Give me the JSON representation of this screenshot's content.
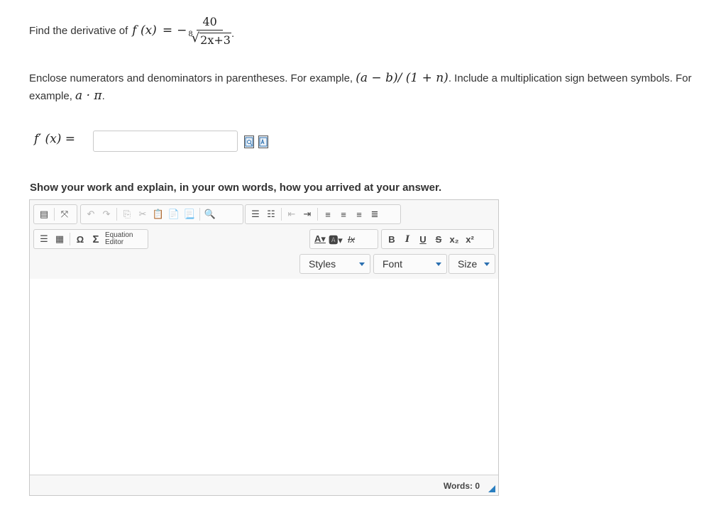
{
  "question": {
    "prefix": "Find the derivative of",
    "function": "f (x)",
    "equals": "=",
    "minus": "−",
    "numerator": "40",
    "root_index": "8",
    "radicand": "2x+3",
    "suffix": "."
  },
  "instructions": {
    "part1": "Enclose numerators and denominators in parentheses. For example,",
    "example1": "(a − b)/ (1 + n)",
    "part2": ". Include a multiplication sign between symbols. For example,",
    "example2": "a · π",
    "part3": "."
  },
  "answer": {
    "label": "f′ (x) =",
    "value": "",
    "placeholder": ""
  },
  "work_prompt": "Show your work and explain, in your own words, how you arrived at your answer.",
  "editor": {
    "equation_editor_line1": "Equation",
    "equation_editor_line2": "Editor",
    "styles_label": "Styles",
    "font_label": "Font",
    "size_label": "Size",
    "content": "",
    "words_label": "Words: 0",
    "toolbar_icons": [
      "source-icon",
      "maximize-icon",
      "undo-icon",
      "redo-icon",
      "copy-icon",
      "cut-icon",
      "paste-icon",
      "paste-text-icon",
      "paste-word-icon",
      "find-icon",
      "numbered-list-icon",
      "bulleted-list-icon",
      "outdent-icon",
      "indent-icon",
      "align-left-icon",
      "align-center-icon",
      "align-right-icon",
      "justify-icon",
      "horizontal-rule-icon",
      "table-icon",
      "special-char-icon",
      "sigma-icon",
      "text-color-icon",
      "bg-color-icon",
      "remove-format-icon",
      "bold-icon",
      "italic-icon",
      "underline-icon",
      "strike-icon",
      "subscript-icon",
      "superscript-icon"
    ]
  },
  "colors": {
    "accent": "#2a7fc0",
    "text": "#333333",
    "border": "#c8c8c8"
  }
}
